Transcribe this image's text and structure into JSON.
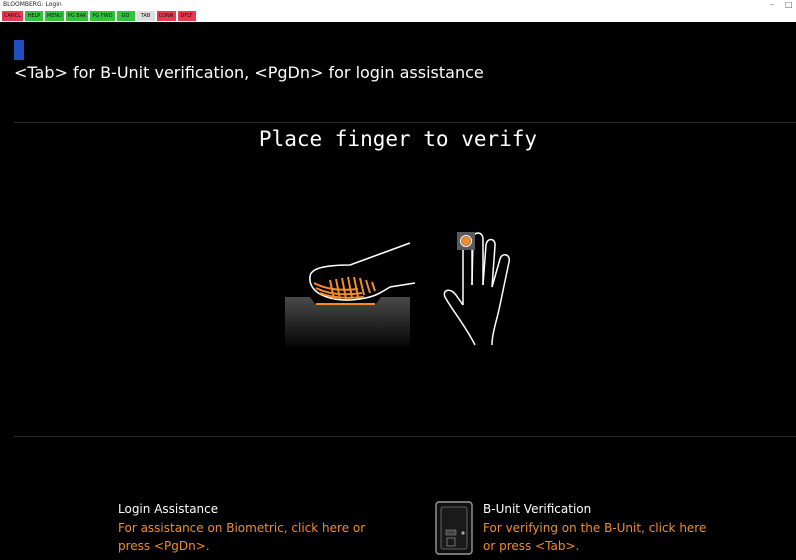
{
  "window": {
    "title": "BLOOMBERG: Login",
    "controls": {
      "minimize": "–",
      "maximize": "□"
    }
  },
  "toolbar": {
    "keys": [
      {
        "label": "CANCL",
        "color": "#e8394e"
      },
      {
        "label": "HELP",
        "color": "#2fc53b"
      },
      {
        "label": "MENU",
        "color": "#2fc53b"
      },
      {
        "label": "PG BAK",
        "color": "#2fc53b"
      },
      {
        "label": "PG FWD",
        "color": "#2fc53b"
      },
      {
        "label": "GO",
        "color": "#2fc53b"
      },
      {
        "label": "TAB",
        "color": "#dedede"
      },
      {
        "label": "CONN",
        "color": "#e8394e"
      },
      {
        "label": "DFLT",
        "color": "#e8394e"
      }
    ]
  },
  "hint": "<Tab> for B-Unit verification, <PgDn> for login assistance",
  "heading": "Place finger to verify",
  "login_assistance": {
    "title": "Login Assistance",
    "text_line1": "For assistance on Biometric, click here or",
    "text_line2": "press <PgDn>."
  },
  "bunit_verification": {
    "title": "B-Unit Verification",
    "text_line1": "For verifying on the B-Unit, click here",
    "text_line2": "or press <Tab>."
  },
  "colors": {
    "accent_orange": "#f28c2a",
    "cursor_blue": "#1f4fbf",
    "background": "#000000"
  },
  "icons": {
    "fingerprint_reader": "finger-on-scanner-icon",
    "hand": "hand-with-sensor-icon",
    "bunit": "bunit-device-icon"
  }
}
